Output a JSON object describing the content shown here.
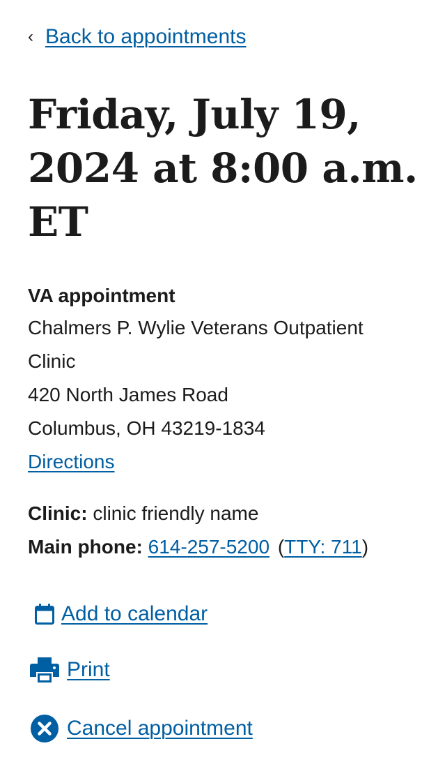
{
  "nav": {
    "back_chevron": "‹",
    "back_label": "Back to appointments"
  },
  "appointment": {
    "title": "Friday, July 19, 2024 at 8:00 a.m. ET",
    "type": "VA appointment",
    "facility_name": "Chalmers P. Wylie Veterans Outpatient Clinic",
    "street": "420 North James Road",
    "city_state_zip": "Columbus, OH 43219-1834",
    "directions_label": "Directions",
    "clinic_label": "Clinic:",
    "clinic_value": "clinic friendly name",
    "phone_label": "Main phone:",
    "phone_value": "614-257-5200",
    "tty_open": "(",
    "tty_value": "TTY: 711",
    "tty_close": ")"
  },
  "actions": {
    "add_to_calendar": {
      "label": "Add to calendar",
      "icon": "calendar-icon"
    },
    "print": {
      "label": "Print",
      "icon": "print-icon"
    },
    "cancel": {
      "label": "Cancel appointment",
      "icon": "cancel-circle-icon"
    }
  },
  "colors": {
    "link": "#005ea2",
    "text": "#1b1b1b",
    "background": "#ffffff"
  }
}
